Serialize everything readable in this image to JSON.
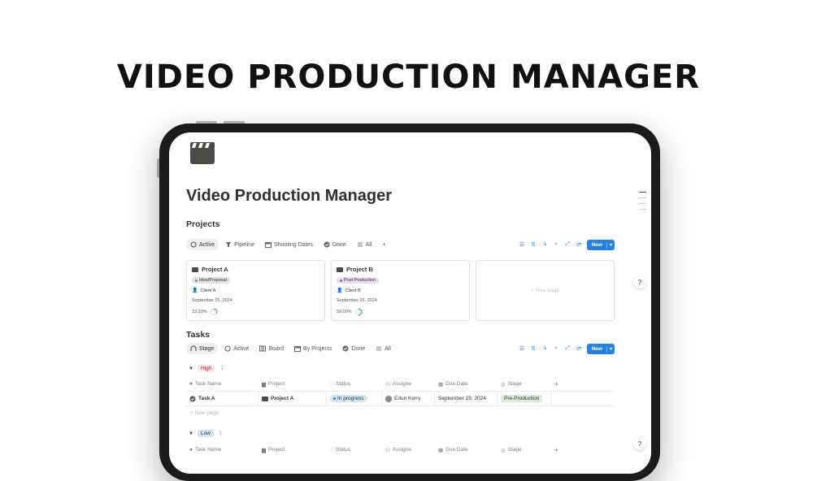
{
  "headline": "VIDEO PRODUCTION MANAGER",
  "page": {
    "icon": "clapperboard-icon",
    "title": "Video Production Manager"
  },
  "projects": {
    "section_title": "Projects",
    "tabs": [
      {
        "label": "Active",
        "icon": "circle-dashed-icon",
        "active": true
      },
      {
        "label": "Pipeline",
        "icon": "pipeline-icon",
        "active": false
      },
      {
        "label": "Shooting Dates",
        "icon": "calendar-icon",
        "active": false
      },
      {
        "label": "Done",
        "icon": "check-circle-icon",
        "active": false
      },
      {
        "label": "All",
        "icon": "list-icon",
        "active": false
      }
    ],
    "add_view": "+",
    "new_button": "New",
    "cards": [
      {
        "title": "Project A",
        "badge": "Idea/Proposal",
        "client": "Client A",
        "date": "September 25, 2024",
        "progress": "33.33%",
        "progress_value": 0.3333
      },
      {
        "title": "Project B",
        "badge": "Post-Production",
        "client": "Client B",
        "date": "September 26, 2024",
        "progress": "50.00%",
        "progress_value": 0.5
      }
    ],
    "new_page_label": "+ New page"
  },
  "tasks": {
    "section_title": "Tasks",
    "tabs": [
      {
        "label": "Stage",
        "icon": "stage-icon",
        "active": true
      },
      {
        "label": "Active",
        "icon": "circle-dashed-icon",
        "active": false
      },
      {
        "label": "Board",
        "icon": "board-icon",
        "active": false
      },
      {
        "label": "By Projects",
        "icon": "calendar-icon",
        "active": false
      },
      {
        "label": "Done",
        "icon": "check-circle-icon",
        "active": false
      },
      {
        "label": "All",
        "icon": "list-icon",
        "active": false
      }
    ],
    "new_button": "New",
    "columns": [
      "Task Name",
      "Project",
      "Status",
      "Assigne",
      "Due Date",
      "Stage"
    ],
    "add_column": "+",
    "groups": [
      {
        "label": "High",
        "count": "1",
        "rows": [
          {
            "task": "Task A",
            "project": "Project A",
            "status": "In progress",
            "assignee": "Edun Kerry",
            "due": "September 29, 2024",
            "stage": "Pre-Production"
          }
        ],
        "new_page": "+ New page"
      },
      {
        "label": "Low",
        "count": "1",
        "rows": []
      }
    ]
  },
  "colors": {
    "accent": "#2383e2",
    "high_tag_bg": "#fbe4e4",
    "low_tag_bg": "#d3e5ef",
    "status_bg": "#d3e5ef",
    "stage_bg": "#dbeddb",
    "idea_badge_bg": "#e3e2e0",
    "post_badge_bg": "#e8deee"
  }
}
